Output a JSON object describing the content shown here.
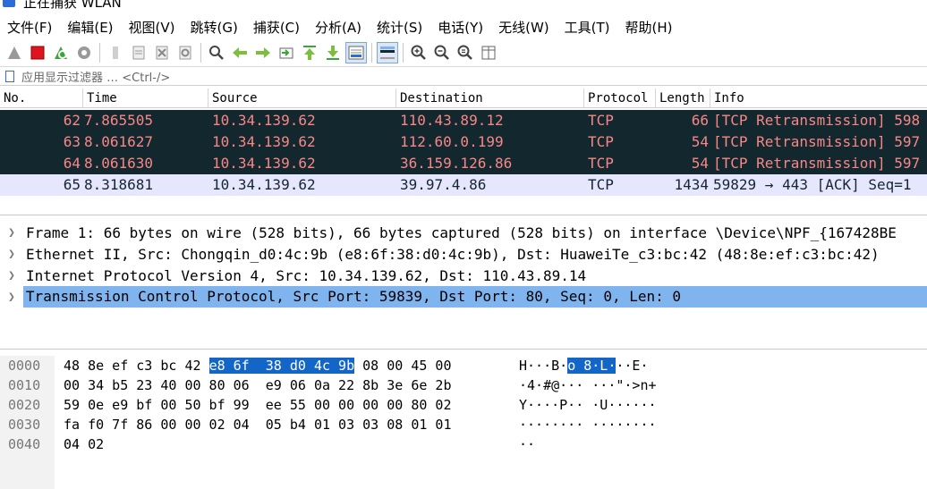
{
  "window": {
    "title": "正在捕获 WLAN"
  },
  "menu": [
    "文件(F)",
    "编辑(E)",
    "视图(V)",
    "跳转(G)",
    "捕获(C)",
    "分析(A)",
    "统计(S)",
    "电话(Y)",
    "无线(W)",
    "工具(T)",
    "帮助(H)"
  ],
  "toolbar": {
    "icons": [
      "shark-fin-start-icon",
      "stop-capture-icon",
      "restart-capture-icon",
      "capture-options-icon",
      "open-file-icon",
      "save-file-icon",
      "close-file-icon",
      "reload-file-icon",
      "find-packet-icon",
      "go-back-icon",
      "go-forward-icon",
      "go-to-packet-icon",
      "go-first-icon",
      "go-last-icon",
      "autoscroll-icon",
      "colorize-icon",
      "zoom-in-icon",
      "zoom-out-icon",
      "zoom-normal-icon",
      "resize-columns-icon"
    ]
  },
  "filter": {
    "placeholder": "应用显示过滤器 … <Ctrl-/>"
  },
  "packet_list": {
    "columns": [
      "No.",
      "Time",
      "Source",
      "Destination",
      "Protocol",
      "Length",
      "Info"
    ],
    "rows": [
      {
        "no": "62",
        "time": "7.865505",
        "src": "10.34.139.62",
        "dst": "110.43.89.12",
        "proto": "TCP",
        "len": "66",
        "info": "[TCP Retransmission] 598",
        "style": "dark"
      },
      {
        "no": "63",
        "time": "8.061627",
        "src": "10.34.139.62",
        "dst": "112.60.0.199",
        "proto": "TCP",
        "len": "54",
        "info": "[TCP Retransmission] 597",
        "style": "dark"
      },
      {
        "no": "64",
        "time": "8.061630",
        "src": "10.34.139.62",
        "dst": "36.159.126.86",
        "proto": "TCP",
        "len": "54",
        "info": "[TCP Retransmission] 597",
        "style": "dark"
      },
      {
        "no": "65",
        "time": "8.318681",
        "src": "10.34.139.62",
        "dst": "39.97.4.86",
        "proto": "TCP",
        "len": "1434",
        "info": "59829 → 443 [ACK] Seq=1",
        "style": "sel"
      }
    ]
  },
  "details": [
    "Frame 1: 66 bytes on wire (528 bits), 66 bytes captured (528 bits) on interface \\Device\\NPF_{167428BE",
    "Ethernet II, Src: Chongqin_d0:4c:9b (e8:6f:38:d0:4c:9b), Dst: HuaweiTe_c3:bc:42 (48:8e:ef:c3:bc:42)",
    "Internet Protocol Version 4, Src: 10.34.139.62, Dst: 110.43.89.14",
    "Transmission Control Protocol, Src Port: 59839, Dst Port: 80, Seq: 0, Len: 0"
  ],
  "hex": [
    {
      "offset": "0000",
      "b1": "48 8e ef c3 bc 42 ",
      "hl": "e8 6f  38 d0 4c 9b",
      "b2": " 08 00 45 00",
      "a1": "H···B·",
      "ahl": "o 8·L·",
      "a2": "··E·"
    },
    {
      "offset": "0010",
      "b1": "00 34 b5 23 40 00 80 06  e9 06 0a 22 8b 3e 6e 2b",
      "hl": "",
      "b2": "",
      "a1": "·4·#@··· ···\"·>n+",
      "ahl": "",
      "a2": ""
    },
    {
      "offset": "0020",
      "b1": "59 0e e9 bf 00 50 bf 99  ee 55 00 00 00 00 80 02",
      "hl": "",
      "b2": "",
      "a1": "Y····P·· ·U······",
      "ahl": "",
      "a2": ""
    },
    {
      "offset": "0030",
      "b1": "fa f0 7f 86 00 00 02 04  05 b4 01 03 03 08 01 01",
      "hl": "",
      "b2": "",
      "a1": "········ ········",
      "ahl": "",
      "a2": ""
    },
    {
      "offset": "0040",
      "b1": "04 02",
      "hl": "",
      "b2": "",
      "a1": "··",
      "ahl": "",
      "a2": ""
    }
  ]
}
